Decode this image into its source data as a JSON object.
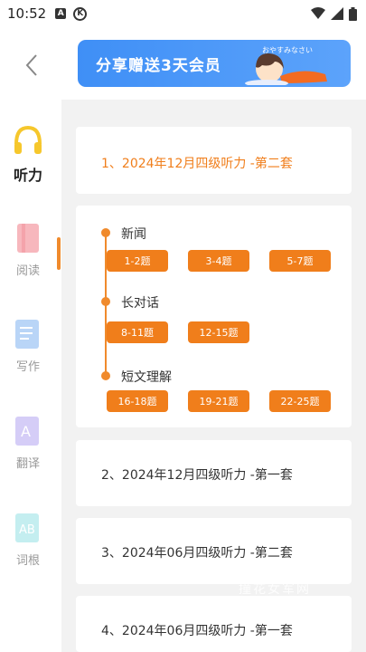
{
  "status_bar": {
    "time": "10:52",
    "icon_a": "A",
    "icon_k": "K"
  },
  "banner": {
    "text": "分享赠送3天会员",
    "art_caption": "おやすみなさい"
  },
  "sidebar": {
    "items": [
      {
        "label": "听力",
        "icon": "headphones-icon",
        "active": true
      },
      {
        "label": "阅读",
        "icon": "book-icon",
        "active": false
      },
      {
        "label": "写作",
        "icon": "document-icon",
        "active": false
      },
      {
        "label": "翻译",
        "icon": "translate-icon",
        "active": false
      },
      {
        "label": "词根",
        "icon": "root-icon",
        "active": false
      }
    ]
  },
  "sets": [
    {
      "title": "1、2024年12月四级听力 -第二套",
      "expanded": true,
      "sections": [
        {
          "name": "新闻",
          "buttons": [
            "1-2题",
            "3-4题",
            "5-7题"
          ]
        },
        {
          "name": "长对话",
          "buttons": [
            "8-11题",
            "12-15题"
          ]
        },
        {
          "name": "短文理解",
          "buttons": [
            "16-18题",
            "19-21题",
            "22-25题"
          ]
        }
      ]
    },
    {
      "title": "2、2024年12月四级听力 -第一套",
      "expanded": false
    },
    {
      "title": "3、2024年06月四级听力 -第二套",
      "expanded": false
    },
    {
      "title": "4、2024年06月四级听力 -第一套",
      "expanded": false
    }
  ],
  "colors": {
    "accent": "#f07e1b",
    "banner": "#3f8ff6",
    "background": "#f2f2f2"
  },
  "watermark": "撞花女军网"
}
